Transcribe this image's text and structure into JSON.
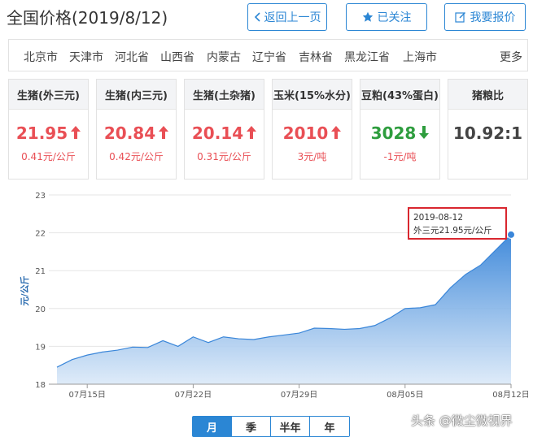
{
  "page": {
    "title": "全国价格(2019/8/12)"
  },
  "header_buttons": {
    "back": "返回上一页",
    "follow": "已关注",
    "quote": "我要报价"
  },
  "regions": {
    "items": [
      "北京市",
      "天津市",
      "河北省",
      "山西省",
      "内蒙古",
      "辽宁省",
      "吉林省",
      "黑龙江省",
      "上海市"
    ],
    "more": "更多"
  },
  "cards": [
    {
      "title": "生猪(外三元)",
      "value": "21.95",
      "trend": "up",
      "change": "0.41元/公斤"
    },
    {
      "title": "生猪(内三元)",
      "value": "20.84",
      "trend": "up",
      "change": "0.42元/公斤"
    },
    {
      "title": "生猪(土杂猪)",
      "value": "20.14",
      "trend": "up",
      "change": "0.31元/公斤"
    },
    {
      "title": "玉米(15%水分)",
      "value": "2010",
      "trend": "up",
      "change": "3元/吨"
    },
    {
      "title": "豆粕(43%蛋白)",
      "value": "3028",
      "trend": "down",
      "change": "-1元/吨"
    },
    {
      "title": "猪粮比",
      "value": "10.92:1",
      "trend": "none",
      "change": ""
    }
  ],
  "colors": {
    "accent": "#2b86d4",
    "up": "#e94f55",
    "down": "#2e9d3e",
    "tooltip_border": "#d9272f",
    "area_top": "#3a86d9",
    "area_bottom": "#dbe9f8"
  },
  "tooltip": {
    "date": "2019-08-12",
    "text": "外三元21.95元/公斤"
  },
  "period_tabs": {
    "items": [
      "月",
      "季",
      "半年",
      "年"
    ],
    "active": 0
  },
  "watermark": "头条 @微尘微视界",
  "chart_data": {
    "type": "area",
    "ylabel": "元/公斤",
    "ylim": [
      18,
      23
    ],
    "yticks": [
      18,
      19,
      20,
      21,
      22,
      23
    ],
    "grid": true,
    "x": [
      "07-13",
      "07-14",
      "07-15",
      "07-16",
      "07-17",
      "07-18",
      "07-19",
      "07-20",
      "07-21",
      "07-22",
      "07-23",
      "07-24",
      "07-25",
      "07-26",
      "07-27",
      "07-28",
      "07-29",
      "07-30",
      "07-31",
      "08-01",
      "08-02",
      "08-03",
      "08-04",
      "08-05",
      "08-06",
      "08-07",
      "08-08",
      "08-09",
      "08-10",
      "08-11",
      "08-12"
    ],
    "x_tick_labels": [
      "07月15日",
      "07月22日",
      "07月29日",
      "08月05日",
      "08月12日"
    ],
    "x_tick_index": [
      2,
      9,
      16,
      23,
      30
    ],
    "series": [
      {
        "values": [
          18.45,
          18.65,
          18.77,
          18.85,
          18.9,
          18.98,
          18.97,
          19.15,
          19.0,
          19.25,
          19.1,
          19.25,
          19.2,
          19.18,
          19.25,
          19.3,
          19.35,
          19.48,
          19.47,
          19.45,
          19.47,
          19.55,
          19.75,
          20.0,
          20.02,
          20.1,
          20.55,
          20.9,
          21.15,
          21.55,
          21.95
        ]
      }
    ]
  }
}
